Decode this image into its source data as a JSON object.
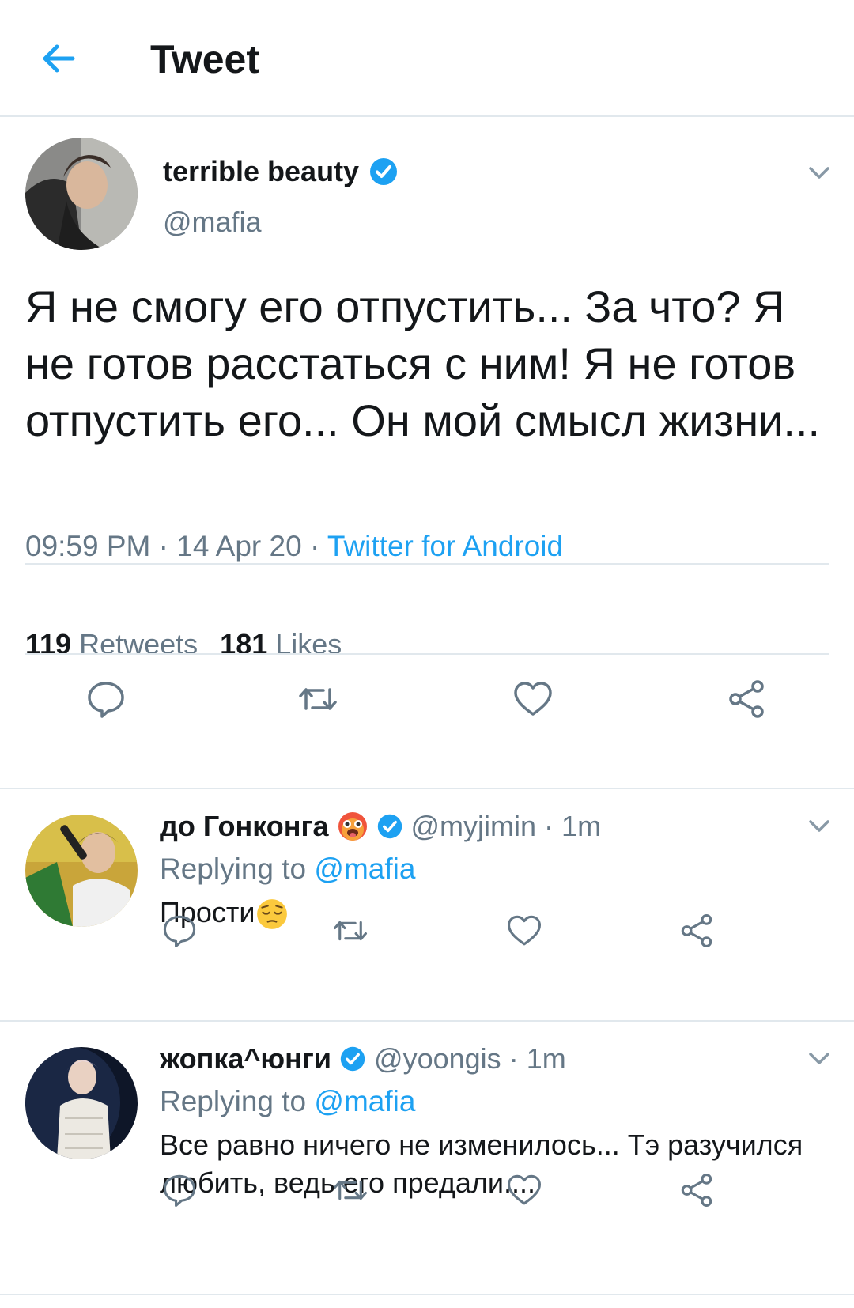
{
  "header": {
    "title": "Tweet",
    "back_icon": "arrow-left-icon"
  },
  "main_tweet": {
    "name": "terrible beauty",
    "handle": "@mafia",
    "verified": true,
    "text": "Я не смогу его отпустить... За что? Я не готов расстаться с ним! Я не готов отпустить его... Он мой смысл жизни...",
    "time": "09:59 PM",
    "date": "14 Apr 20",
    "source": "Twitter for Android",
    "retweets_count": "119",
    "retweets_label": "Retweets",
    "likes_count": "181",
    "likes_label": "Likes"
  },
  "replies": [
    {
      "name": "до Гонконга",
      "emoji": "hot-face-emoji",
      "verified": true,
      "handle": "@myjimin",
      "time": "1m",
      "replying_prefix": "Replying to",
      "replying_to": "@mafia",
      "text": "Прости",
      "text_emoji": "pensive-face-emoji"
    },
    {
      "name": "жопка^юнги",
      "verified": true,
      "handle": "@yoongis",
      "time": "1m",
      "replying_prefix": "Replying to",
      "replying_to": "@mafia",
      "text": "Все равно ничего не изменилось... Тэ разучился любить, ведь его предали...."
    }
  ],
  "colors": {
    "accent": "#1da1f2",
    "muted": "#657786",
    "text": "#14171a",
    "divider": "#e1e8ed"
  },
  "separator": "·"
}
